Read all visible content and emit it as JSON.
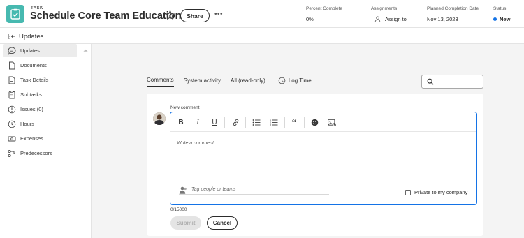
{
  "header": {
    "kind": "TASK",
    "title": "Schedule Core Team Education",
    "share_label": "Share",
    "more_label": "•••",
    "meta": {
      "percent_label": "Percent Complete",
      "percent_value": "0%",
      "assignments_label": "Assignments",
      "assignments_value": "Assign to",
      "completion_label": "Planned Completion Date",
      "completion_value": "Nov 13, 2023",
      "status_label": "Status",
      "status_value": "New",
      "status_color": "#1473e6"
    },
    "task_icon_color": "#47b9b0"
  },
  "updates_bar": {
    "title": "Updates"
  },
  "sidebar": {
    "items": [
      {
        "label": "Updates",
        "icon": "chat-bubble-icon"
      },
      {
        "label": "Documents",
        "icon": "document-icon"
      },
      {
        "label": "Task Details",
        "icon": "task-details-icon"
      },
      {
        "label": "Subtasks",
        "icon": "subtasks-icon"
      },
      {
        "label": "Issues (0)",
        "icon": "issues-icon"
      },
      {
        "label": "Hours",
        "icon": "clock-icon"
      },
      {
        "label": "Expenses",
        "icon": "money-icon"
      },
      {
        "label": "Predecessors",
        "icon": "predecessors-icon"
      }
    ]
  },
  "tabs": {
    "items": [
      {
        "label": "Comments"
      },
      {
        "label": "System activity"
      },
      {
        "label": "All (read-only)"
      }
    ],
    "log_time": "Log Time"
  },
  "comment": {
    "new_comment_label": "New comment",
    "placeholder": "Write a comment...",
    "tag_placeholder": "Tag people or teams",
    "private_label": "Private to my company",
    "counter": "0/15000",
    "submit_label": "Submit",
    "cancel_label": "Cancel",
    "accent_color": "#1473e6"
  }
}
